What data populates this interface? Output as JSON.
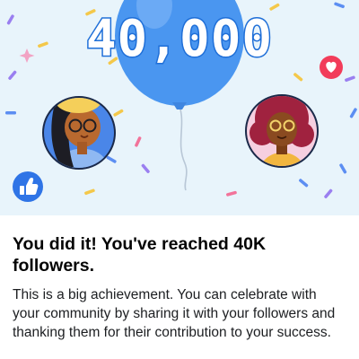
{
  "celebration": {
    "follower_count": "40,000",
    "headline": "You did it! You've reached 40K followers.",
    "message": "This is a big achievement. You can celebrate with your community by sharing it with your followers and thanking them for their contribution to your success."
  },
  "icons": {
    "balloon": "balloon-icon",
    "like": "thumbs-up-icon",
    "love": "heart-icon",
    "sparkle": "sparkle-icon"
  },
  "colors": {
    "hero_background": "#e8f4fb",
    "balloon": "#4a96f0",
    "like_badge": "#2f74e6",
    "love_badge": "#f23c5a",
    "text_primary": "#050505"
  }
}
